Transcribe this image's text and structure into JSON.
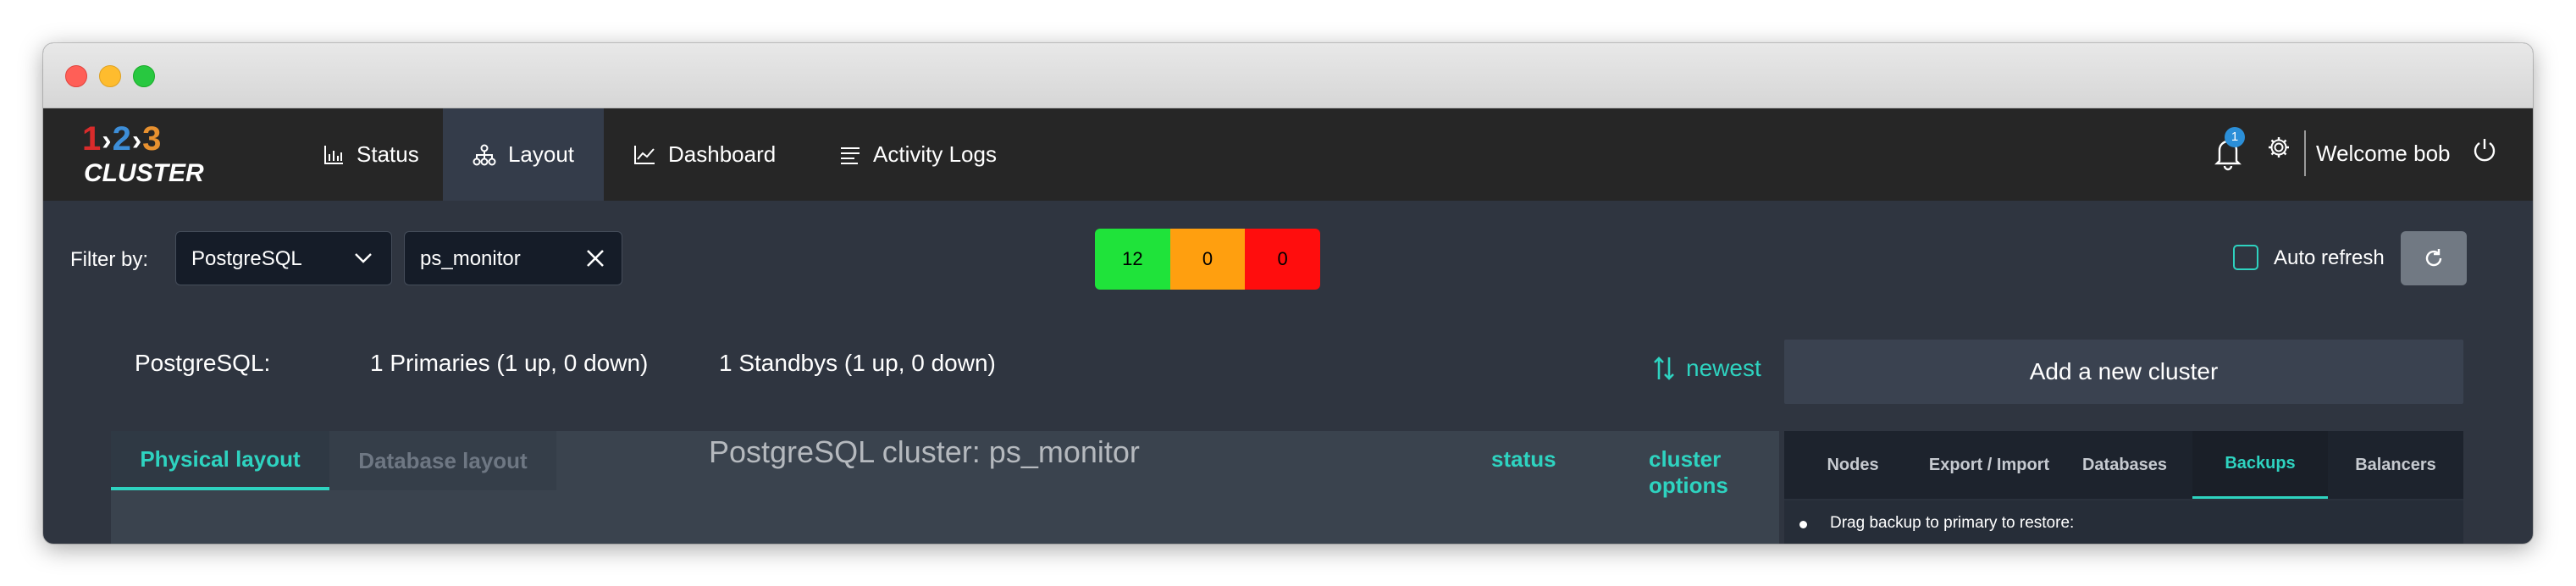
{
  "logo": {
    "n1": "1",
    "n2": "2",
    "n3": "3",
    "text": "CLUSTER"
  },
  "nav": [
    {
      "label": "Status",
      "icon": "bar-chart-icon"
    },
    {
      "label": "Layout",
      "icon": "sitemap-icon",
      "active": true
    },
    {
      "label": "Dashboard",
      "icon": "line-chart-icon"
    },
    {
      "label": "Activity Logs",
      "icon": "list-icon"
    }
  ],
  "header": {
    "notification_count": "1",
    "welcome": "Welcome bob"
  },
  "filter": {
    "label": "Filter by:",
    "type_value": "PostgreSQL",
    "search_value": "ps_monitor"
  },
  "counts": {
    "up": "12",
    "warning": "0",
    "down": "0"
  },
  "colors": {
    "accent": "#2ed3c0",
    "up": "#1fe33a",
    "warning": "#ff9f0f",
    "down": "#ff0d0d"
  },
  "autorefresh": {
    "label": "Auto refresh",
    "checked": false
  },
  "summary": {
    "kind": "PostgreSQL:",
    "primaries": "1 Primaries (1 up, 0 down)",
    "standbys": "1 Standbys (1 up, 0 down)"
  },
  "sort": {
    "label": "newest"
  },
  "add_cluster_label": "Add a new cluster",
  "layout_tabs": {
    "physical": "Physical layout",
    "database": "Database layout"
  },
  "cluster_title": "PostgreSQL cluster: ps_monitor",
  "panel_links": {
    "status": "status",
    "options": "cluster options"
  },
  "right_tabs": [
    "Nodes",
    "Export / Import",
    "Databases",
    "Backups",
    "Balancers"
  ],
  "right_tabs_active": "Backups",
  "backups_hint": "Drag backup to primary to restore:"
}
